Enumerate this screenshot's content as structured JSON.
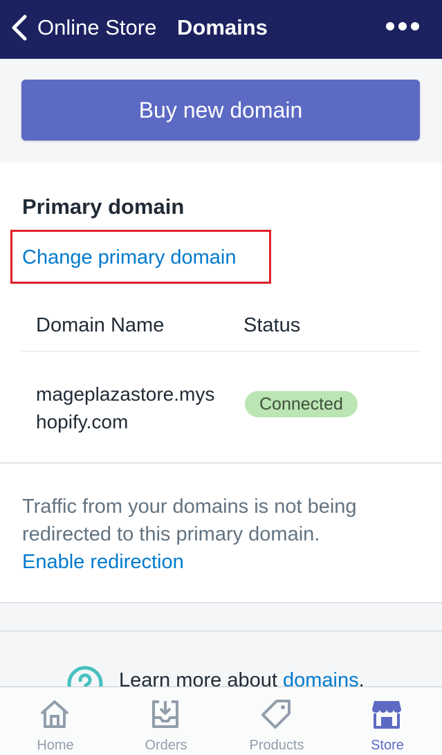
{
  "header": {
    "back_label": "Online Store",
    "title": "Domains",
    "more_icon": "ellipsis-icon"
  },
  "buy": {
    "button_label": "Buy new domain"
  },
  "primary": {
    "heading": "Primary domain",
    "change_link": "Change primary domain",
    "highlight_color": "#e0202a",
    "columns": {
      "name": "Domain Name",
      "status": "Status"
    },
    "rows": [
      {
        "domain": "mageplazastore.myshopify.com",
        "status": "Connected"
      }
    ]
  },
  "traffic": {
    "message": "Traffic from your domains is not being redirected to this primary domain.",
    "link": "Enable redirection"
  },
  "learn": {
    "prefix": "Learn more about ",
    "link": "domains",
    "suffix": "."
  },
  "tabs": [
    {
      "label": "Home",
      "icon": "home-icon",
      "active": false
    },
    {
      "label": "Orders",
      "icon": "orders-inbox-icon",
      "active": false
    },
    {
      "label": "Products",
      "icon": "tag-icon",
      "active": false
    },
    {
      "label": "Store",
      "icon": "storefront-icon",
      "active": true
    }
  ],
  "colors": {
    "nav_bg": "#1c2260",
    "primary_button": "#5c6ac4",
    "link": "#007ace",
    "badge_bg": "#bbe5b3",
    "active_tab": "#5c6ac4"
  }
}
